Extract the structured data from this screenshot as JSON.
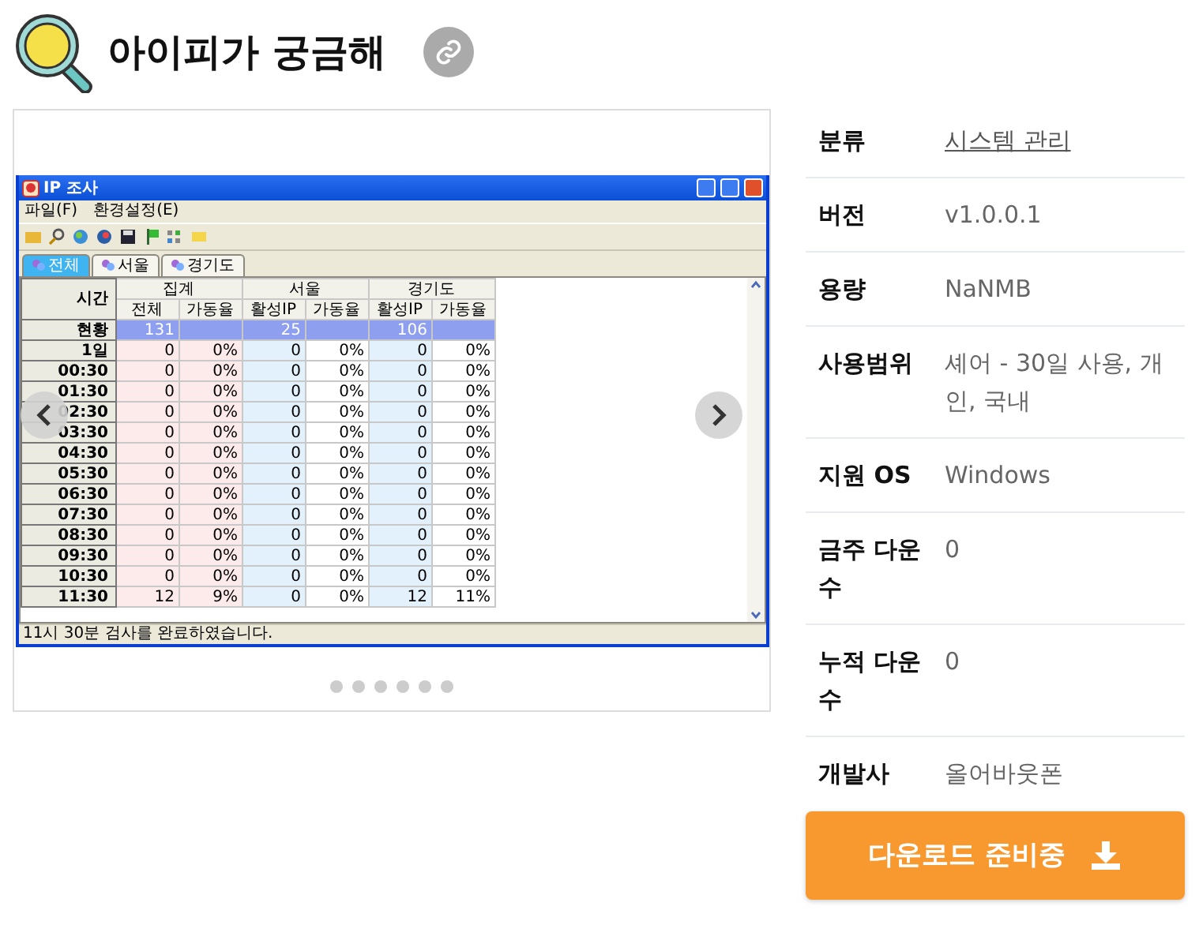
{
  "header": {
    "title": "아이피가 궁금해"
  },
  "screenshot": {
    "window_title": "IP 조사",
    "menus": [
      "파일(F)",
      "환경설정(E)"
    ],
    "tabs": [
      {
        "label": "전체",
        "selected": true
      },
      {
        "label": "서울",
        "selected": false
      },
      {
        "label": "경기도",
        "selected": false
      }
    ],
    "table": {
      "corner": "시간",
      "groups": [
        "집계",
        "서울",
        "경기도"
      ],
      "columns": [
        "전체",
        "가동율",
        "활성IP",
        "가동율",
        "활성IP",
        "가동율"
      ],
      "rows": [
        {
          "time": "현황",
          "selected": true,
          "cells": [
            "131",
            null,
            "25",
            null,
            "106",
            null
          ]
        },
        {
          "time": "1일",
          "selected": false,
          "cells": [
            "0",
            "0%",
            "0",
            "0%",
            "0",
            "0%"
          ]
        },
        {
          "time": "00:30",
          "selected": false,
          "cells": [
            "0",
            "0%",
            "0",
            "0%",
            "0",
            "0%"
          ]
        },
        {
          "time": "01:30",
          "selected": false,
          "cells": [
            "0",
            "0%",
            "0",
            "0%",
            "0",
            "0%"
          ]
        },
        {
          "time": "02:30",
          "selected": false,
          "cells": [
            "0",
            "0%",
            "0",
            "0%",
            "0",
            "0%"
          ]
        },
        {
          "time": "03:30",
          "selected": false,
          "cells": [
            "0",
            "0%",
            "0",
            "0%",
            "0",
            "0%"
          ]
        },
        {
          "time": "04:30",
          "selected": false,
          "cells": [
            "0",
            "0%",
            "0",
            "0%",
            "0",
            "0%"
          ]
        },
        {
          "time": "05:30",
          "selected": false,
          "cells": [
            "0",
            "0%",
            "0",
            "0%",
            "0",
            "0%"
          ]
        },
        {
          "time": "06:30",
          "selected": false,
          "cells": [
            "0",
            "0%",
            "0",
            "0%",
            "0",
            "0%"
          ]
        },
        {
          "time": "07:30",
          "selected": false,
          "cells": [
            "0",
            "0%",
            "0",
            "0%",
            "0",
            "0%"
          ]
        },
        {
          "time": "08:30",
          "selected": false,
          "cells": [
            "0",
            "0%",
            "0",
            "0%",
            "0",
            "0%"
          ]
        },
        {
          "time": "09:30",
          "selected": false,
          "cells": [
            "0",
            "0%",
            "0",
            "0%",
            "0",
            "0%"
          ]
        },
        {
          "time": "10:30",
          "selected": false,
          "cells": [
            "0",
            "0%",
            "0",
            "0%",
            "0",
            "0%"
          ]
        },
        {
          "time": "11:30",
          "selected": false,
          "cells": [
            "12",
            "9%",
            "0",
            "0%",
            "12",
            "11%"
          ]
        }
      ]
    },
    "status": "11시 30분 검사를 완료하였습니다."
  },
  "carousel": {
    "slides": [
      {
        "selected": false
      },
      {
        "selected": false
      },
      {
        "selected": false
      },
      {
        "selected": false
      },
      {
        "selected": false
      },
      {
        "selected": false
      }
    ]
  },
  "details": [
    {
      "label": "분류",
      "value": "시스템 관리",
      "kind": "link"
    },
    {
      "label": "버전",
      "value": "v1.0.0.1",
      "kind": "text"
    },
    {
      "label": "용량",
      "value": "NaNMB",
      "kind": "text"
    },
    {
      "label": "사용범위",
      "value": "셰어 - 30일 사용, 개인, 국내",
      "kind": "text"
    },
    {
      "label": "지원 OS",
      "value": "Windows",
      "kind": "text"
    },
    {
      "label": "금주 다운수",
      "value": "0",
      "kind": "text"
    },
    {
      "label": "누적 다운수",
      "value": "0",
      "kind": "text"
    },
    {
      "label": "개발사",
      "value": "올어바웃폰",
      "kind": "text"
    }
  ],
  "download_button": {
    "label": "다운로드 준비중"
  }
}
